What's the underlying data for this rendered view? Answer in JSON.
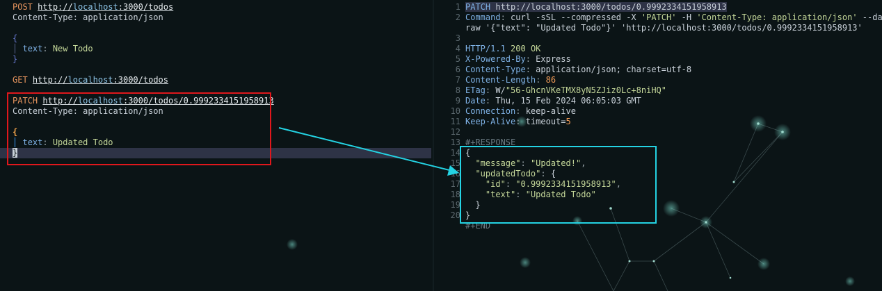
{
  "left": {
    "post_method": "POST",
    "post_url_pre": "http://",
    "post_url_host": "localhost",
    "post_url_post": ":3000/todos",
    "post_header": "Content-Type: application/json",
    "post_open_brace": "{",
    "post_body_key": "text",
    "post_body_sep": ": ",
    "post_body_value": "New Todo",
    "post_close_brace": "}",
    "get_method": "GET",
    "get_url_pre": "http://",
    "get_url_host": "localhost",
    "get_url_post": ":3000/todos",
    "patch_method": "PATCH",
    "patch_url_pre": "http://",
    "patch_url_host": "localhost",
    "patch_url_post": ":3000/todos/0.9992334151958913",
    "patch_header": "Content-Type: application/json",
    "patch_open_brace": "{",
    "patch_body_key": "text",
    "patch_body_sep": ": ",
    "patch_body_value": "Updated Todo",
    "patch_close_brace": "}"
  },
  "right": {
    "line_numbers": [
      "1",
      "2",
      "",
      "3",
      "4",
      "5",
      "6",
      "7",
      "8",
      "9",
      "10",
      "11",
      "12",
      "13",
      "14",
      "15",
      "16",
      "17",
      "18",
      "19",
      "20"
    ],
    "request_method": "PATCH",
    "request_url": "http://localhost:3000/todos/0.9992334151958913",
    "command_label": "Command",
    "command_a": "curl -sSL --compressed -X ",
    "command_b": "'PATCH'",
    "command_c": " -H ",
    "command_d": "'Content-Type: application/json'",
    "command_e": " --data-",
    "command_f": "raw '{\"text\": \"Updated Todo\"}' 'http://localhost:3000/todos/0.9992334151958913'",
    "status_proto": "HTTP/1.1",
    "status_code": "200",
    "status_text": "OK",
    "h_powered_key": "X-Powered-By",
    "h_powered_val": "Express",
    "h_ctype_key": "Content-Type",
    "h_ctype_val": "application/json; charset=utf-8",
    "h_clen_key": "Content-Length",
    "h_clen_val": "86",
    "h_etag_key": "ETag",
    "h_etag_w": "W/",
    "h_etag_val": "\"56-GhcnVKeTMX8yN5ZJiz0Lc+8niHQ\"",
    "h_date_key": "Date",
    "h_date_val": "Thu, 15 Feb 2024 06:05:03 GMT",
    "h_conn_key": "Connection",
    "h_conn_val": "keep-alive",
    "h_ka_key": "Keep-Alive",
    "h_ka_val": "timeout=",
    "h_ka_num": "5",
    "response_marker": "#+RESPONSE",
    "json_open": "{",
    "json_msg_key": "\"message\"",
    "json_msg_val": "\"Updated!\"",
    "json_upd_key": "\"updatedTodo\"",
    "json_upd_open": "{",
    "json_id_key": "\"id\"",
    "json_id_val": "\"0.9992334151958913\"",
    "json_text_key": "\"text\"",
    "json_text_val": "\"Updated Todo\"",
    "json_inner_close": "}",
    "json_close": "}",
    "end_marker": "#+END"
  },
  "colors": {
    "background": "#0b1416",
    "annotation_red": "#e0171c",
    "annotation_cyan": "#24d3e3",
    "current_line": "#2e3346"
  }
}
